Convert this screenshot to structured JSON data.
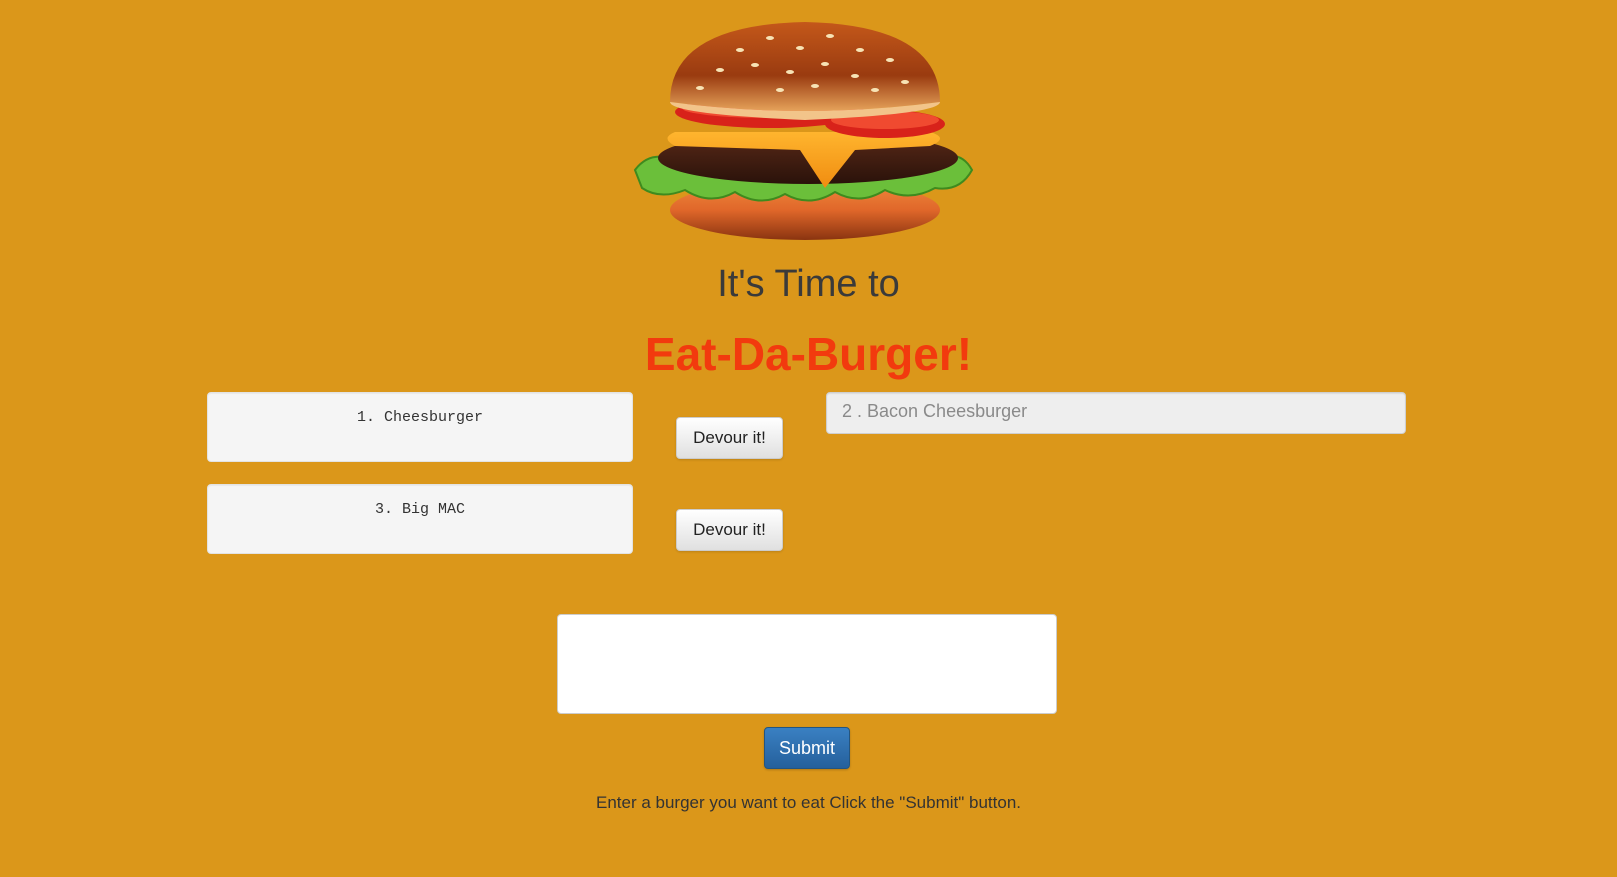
{
  "header": {
    "line1": "It's Time to",
    "line2": "Eat-Da-Burger!"
  },
  "burgers_to_eat": [
    {
      "label": "1. Cheesburger",
      "button_label": "Devour it!"
    },
    {
      "label": "3. Big MAC",
      "button_label": "Devour it!"
    }
  ],
  "devoured_burgers": [
    {
      "label": "2 . Bacon Cheesburger"
    }
  ],
  "form": {
    "textarea_value": "",
    "submit_label": "Submit",
    "instructions": "Enter a burger you want to eat Click the \"Submit\" button."
  },
  "colors": {
    "background": "#DB971A",
    "title_accent": "#F23A0E",
    "submit_button": "#2E6DA4"
  },
  "icons": {
    "logo": "burger-image"
  }
}
